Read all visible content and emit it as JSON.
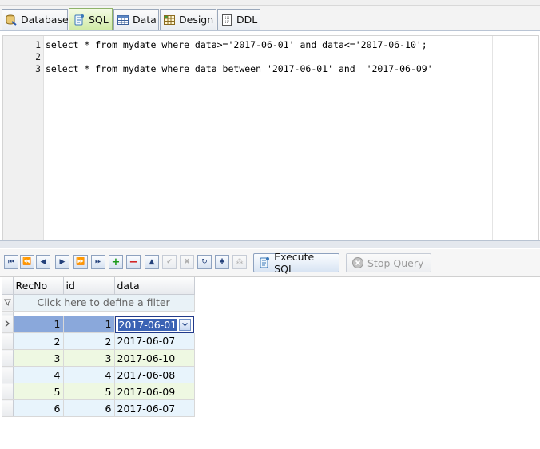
{
  "tabs": [
    {
      "label": "Database",
      "icon": "database-icon",
      "active": false
    },
    {
      "label": "SQL",
      "icon": "sql-scroll-icon",
      "active": true
    },
    {
      "label": "Data",
      "icon": "table-data-icon",
      "active": false
    },
    {
      "label": "Design",
      "icon": "table-design-icon",
      "active": false
    },
    {
      "label": "DDL",
      "icon": "ddl-document-icon",
      "active": false
    }
  ],
  "editor": {
    "line_numbers": [
      "1",
      "2",
      "3"
    ],
    "lines": [
      "select * from mydate where data>='2017-06-01' and data<='2017-06-10';",
      "",
      "select * from mydate where data between '2017-06-01' and  '2017-06-09'"
    ]
  },
  "toolbar": {
    "execute_label": "Execute SQL",
    "stop_label": "Stop Query"
  },
  "grid": {
    "columns": [
      "RecNo",
      "id",
      "data"
    ],
    "filter_placeholder": "Click here to define a filter",
    "rows": [
      {
        "recno": "1",
        "id": "1",
        "data": "2017-06-01"
      },
      {
        "recno": "2",
        "id": "2",
        "data": "2017-06-07"
      },
      {
        "recno": "3",
        "id": "3",
        "data": "2017-06-10"
      },
      {
        "recno": "4",
        "id": "4",
        "data": "2017-06-08"
      },
      {
        "recno": "5",
        "id": "5",
        "data": "2017-06-09"
      },
      {
        "recno": "6",
        "id": "6",
        "data": "2017-06-07"
      }
    ],
    "selected_row": 1
  },
  "colors": {
    "active_tab": "#cfeaa4",
    "selection": "#8aa8db",
    "row_blue": "#e8f4fc",
    "row_green": "#eef8e2"
  }
}
